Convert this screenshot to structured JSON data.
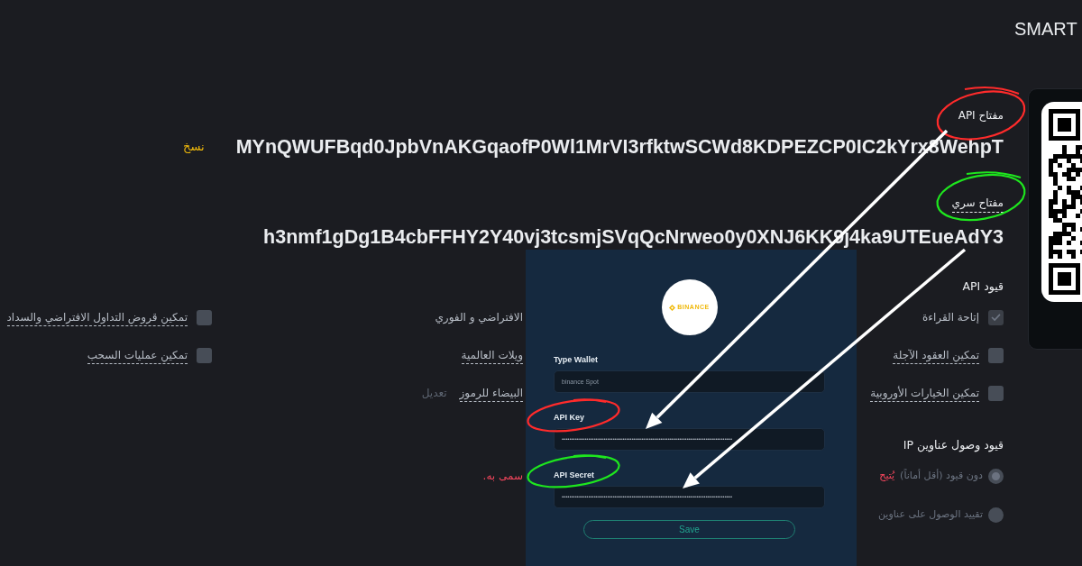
{
  "header": {
    "title": "SMART"
  },
  "api_key": {
    "label": "مفتاح API",
    "underlined": false,
    "value": "MYnQWUFBqd0JpbVnAKGqaofP0Wl1MrVI3rfktwSCWd8KDPEZCP0IC2kYrx8WehpT",
    "copy": "نسخ"
  },
  "secret_key": {
    "label": "مفتاح سري",
    "underlined": true,
    "value": "h3nmf1gDg1B4cbFFHY2Y40vj3tcsmjSVqQcNrweo0y0XNJ6KK9j4ka9UTEueAdY3"
  },
  "api_restrictions": {
    "title": "قيود API",
    "columns": [
      {
        "items": [
          {
            "kind": "checkbox",
            "label": "إتاحة القراءة",
            "checked": true,
            "underlined": false
          },
          {
            "kind": "checkbox",
            "label": "تمكين العقود الآجلة",
            "checked": false,
            "underlined": true
          },
          {
            "kind": "checkbox",
            "label": "تمكين الخيارات الأوروبية",
            "checked": false,
            "underlined": true
          }
        ]
      },
      {
        "items": [
          {
            "kind": "text",
            "label": "الافتراضي و الفوري",
            "underlined": false
          },
          {
            "kind": "text",
            "label": "ويلات العالمية",
            "underlined": true
          },
          {
            "kind": "text",
            "label": "البيضاء للرموز",
            "underlined": true,
            "action": "تعديل"
          }
        ]
      },
      {
        "items": [
          {
            "kind": "checkbox",
            "label": "تمكين قروض التداول الافتراضي والسداد",
            "checked": false,
            "underlined": true
          },
          {
            "kind": "checkbox",
            "label": "تمكين عمليات السحب",
            "checked": false,
            "underlined": true
          }
        ]
      }
    ]
  },
  "ip_restrictions": {
    "title": "قيود وصول عناوين IP",
    "options": [
      {
        "label": "دون قيود (أقل أماناً)",
        "warning": "يُتيح",
        "warning_continued": "سمى به.",
        "selected": true
      },
      {
        "label": "تقييد الوصول على عناوين",
        "selected": false
      }
    ]
  },
  "wallet_form": {
    "logo": "BINANCE",
    "fields": [
      {
        "label": "Type Wallet",
        "placeholder": "binance Spot"
      },
      {
        "label": "API Key",
        "value": "••••••••••••••••••••••••••••••••••••••••••••••••••••••••••••••••••••••••••••••••••••••••••"
      },
      {
        "label": "API Secret",
        "value": "••••••••••••••••••••••••••••••••••••••••••••••••••••••••••••••••••••••••••••••••••••••••••"
      }
    ],
    "button": "Save"
  }
}
